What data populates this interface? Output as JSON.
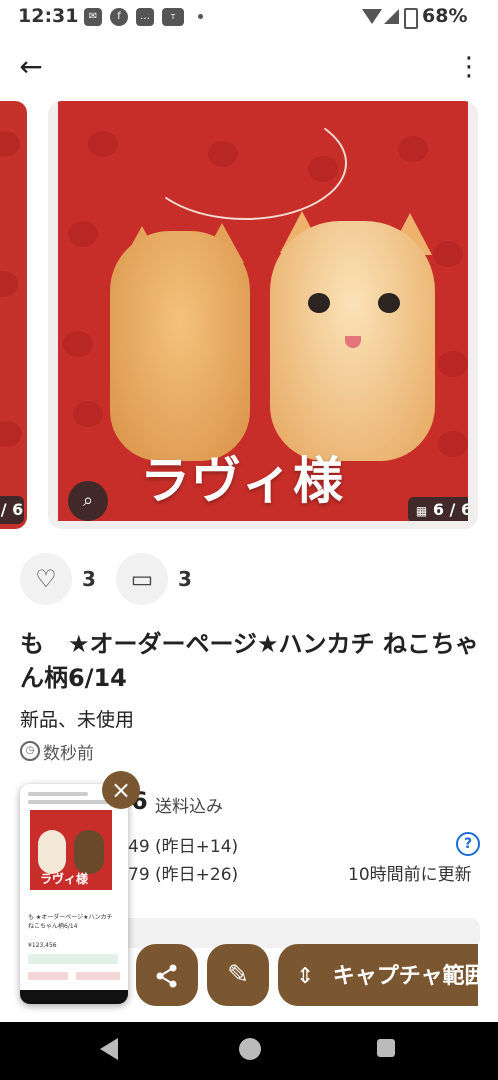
{
  "status_bar": {
    "time": "12:31",
    "battery": "68%",
    "icons": [
      "message-icon",
      "facebook-icon",
      "chat-icon",
      "temu-icon",
      "wifi-icon",
      "signal-icon",
      "battery-icon"
    ]
  },
  "nav": {
    "back_icon": "←",
    "more_icon": "⋮"
  },
  "gallery": {
    "prev_counter": "/ 6",
    "image_caption": "ラヴィ様",
    "counter": "6 / 6",
    "counter_icon": "grid-icon"
  },
  "reactions": {
    "like_count": "3",
    "comment_count": "3"
  },
  "item": {
    "title": "も　★オーダーページ★ハンカチ ねこちゃん柄6/14",
    "condition": "新品、未使用",
    "posted": "数秒前",
    "price_suffix": "6",
    "shipping": "送料込み",
    "stat1": "49 (昨日+14)",
    "stat2": "79 (昨日+26)",
    "help": "?",
    "updated": "10時間前に更新"
  },
  "thumbnail": {
    "caption": "ラヴィ様",
    "title": "も ★オーダーページ★ハンカチ ねこちゃん柄6/14",
    "price": "¥123,456"
  },
  "toolbar": {
    "close": "×",
    "capture_label": "キャプチャ範囲"
  },
  "colors": {
    "accent": "#7a5730",
    "image_bg": "#c72e29"
  }
}
